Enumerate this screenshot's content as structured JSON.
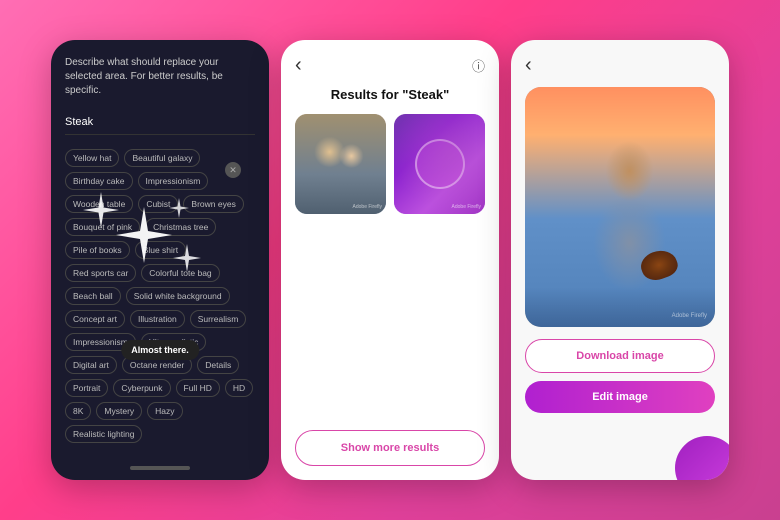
{
  "panel1": {
    "describe_text": "Describe what should replace your selected area. For better results, be specific.",
    "input_value": "Steak",
    "tags": [
      "Yellow hat",
      "Beautiful galaxy",
      "Birthday cake",
      "Impressionism",
      "Wooden table",
      "Cubist",
      "Brown eyes",
      "Bouquet of pink",
      "Christmas tree",
      "Pile of books",
      "Blue shirt",
      "Red sports car",
      "Colorful tote bag",
      "Beach ball",
      "Solid white background",
      "Concept art",
      "Illustration",
      "Surrealism",
      "Impressionism",
      "Ultra-realistic",
      "Digital art",
      "Octane render",
      "Details",
      "Portrait",
      "Cyberpunk",
      "Full HD",
      "HD",
      "8K",
      "Mystery",
      "Hazy",
      "Realistic lighting"
    ],
    "almost_there": "Almost there."
  },
  "panel2": {
    "title": "Results for \"Steak\"",
    "back_icon": "‹",
    "info_icon": "ⓘ",
    "show_more_label": "Show more results",
    "watermark1": "Adobe Firefly",
    "watermark2": "Adobe Firefly"
  },
  "panel3": {
    "back_icon": "‹",
    "download_label": "Download image",
    "edit_label": "Edit image",
    "watermark": "Adobe Firefly"
  }
}
